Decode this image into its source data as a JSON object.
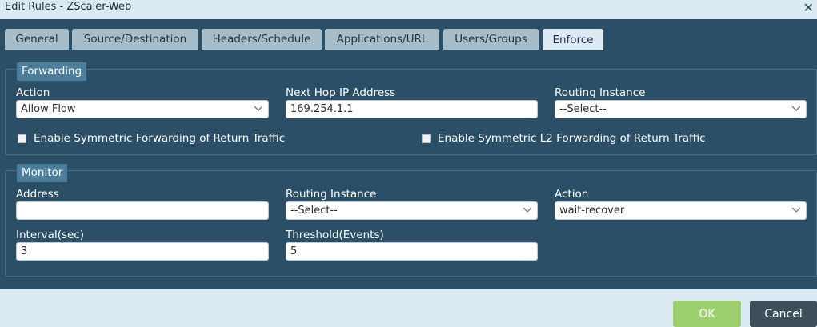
{
  "dialog": {
    "title": "Edit Rules - ZScaler-Web"
  },
  "tabs": [
    {
      "label": "General"
    },
    {
      "label": "Source/Destination"
    },
    {
      "label": "Headers/Schedule"
    },
    {
      "label": "Applications/URL"
    },
    {
      "label": "Users/Groups"
    },
    {
      "label": "Enforce"
    }
  ],
  "active_tab": "Enforce",
  "forwarding": {
    "legend": "Forwarding",
    "action": {
      "label": "Action",
      "value": "Allow Flow"
    },
    "next_hop": {
      "label": "Next Hop IP Address",
      "value": "169.254.1.1"
    },
    "routing_instance": {
      "label": "Routing Instance",
      "value": "--Select--"
    },
    "symmetric_forwarding": {
      "label": "Enable Symmetric Forwarding of Return Traffic",
      "checked": false
    },
    "symmetric_l2_forwarding": {
      "label": "Enable Symmetric L2 Forwarding of Return Traffic",
      "checked": false
    }
  },
  "monitor": {
    "legend": "Monitor",
    "address": {
      "label": "Address",
      "value": ""
    },
    "routing_instance": {
      "label": "Routing Instance",
      "value": "--Select--"
    },
    "action": {
      "label": "Action",
      "value": "wait-recover"
    },
    "interval": {
      "label": "Interval(sec)",
      "value": "3"
    },
    "threshold": {
      "label": "Threshold(Events)",
      "value": "5"
    }
  },
  "buttons": {
    "ok": "OK",
    "cancel": "Cancel"
  },
  "colors": {
    "body_bg": "#2b4f67",
    "chrome_bg": "#dcebf3",
    "tab_inactive": "#a7bdca",
    "legend_bg": "#4d7e9b",
    "ok_button": "#9fd070",
    "cancel_button": "#3d4f5a"
  }
}
